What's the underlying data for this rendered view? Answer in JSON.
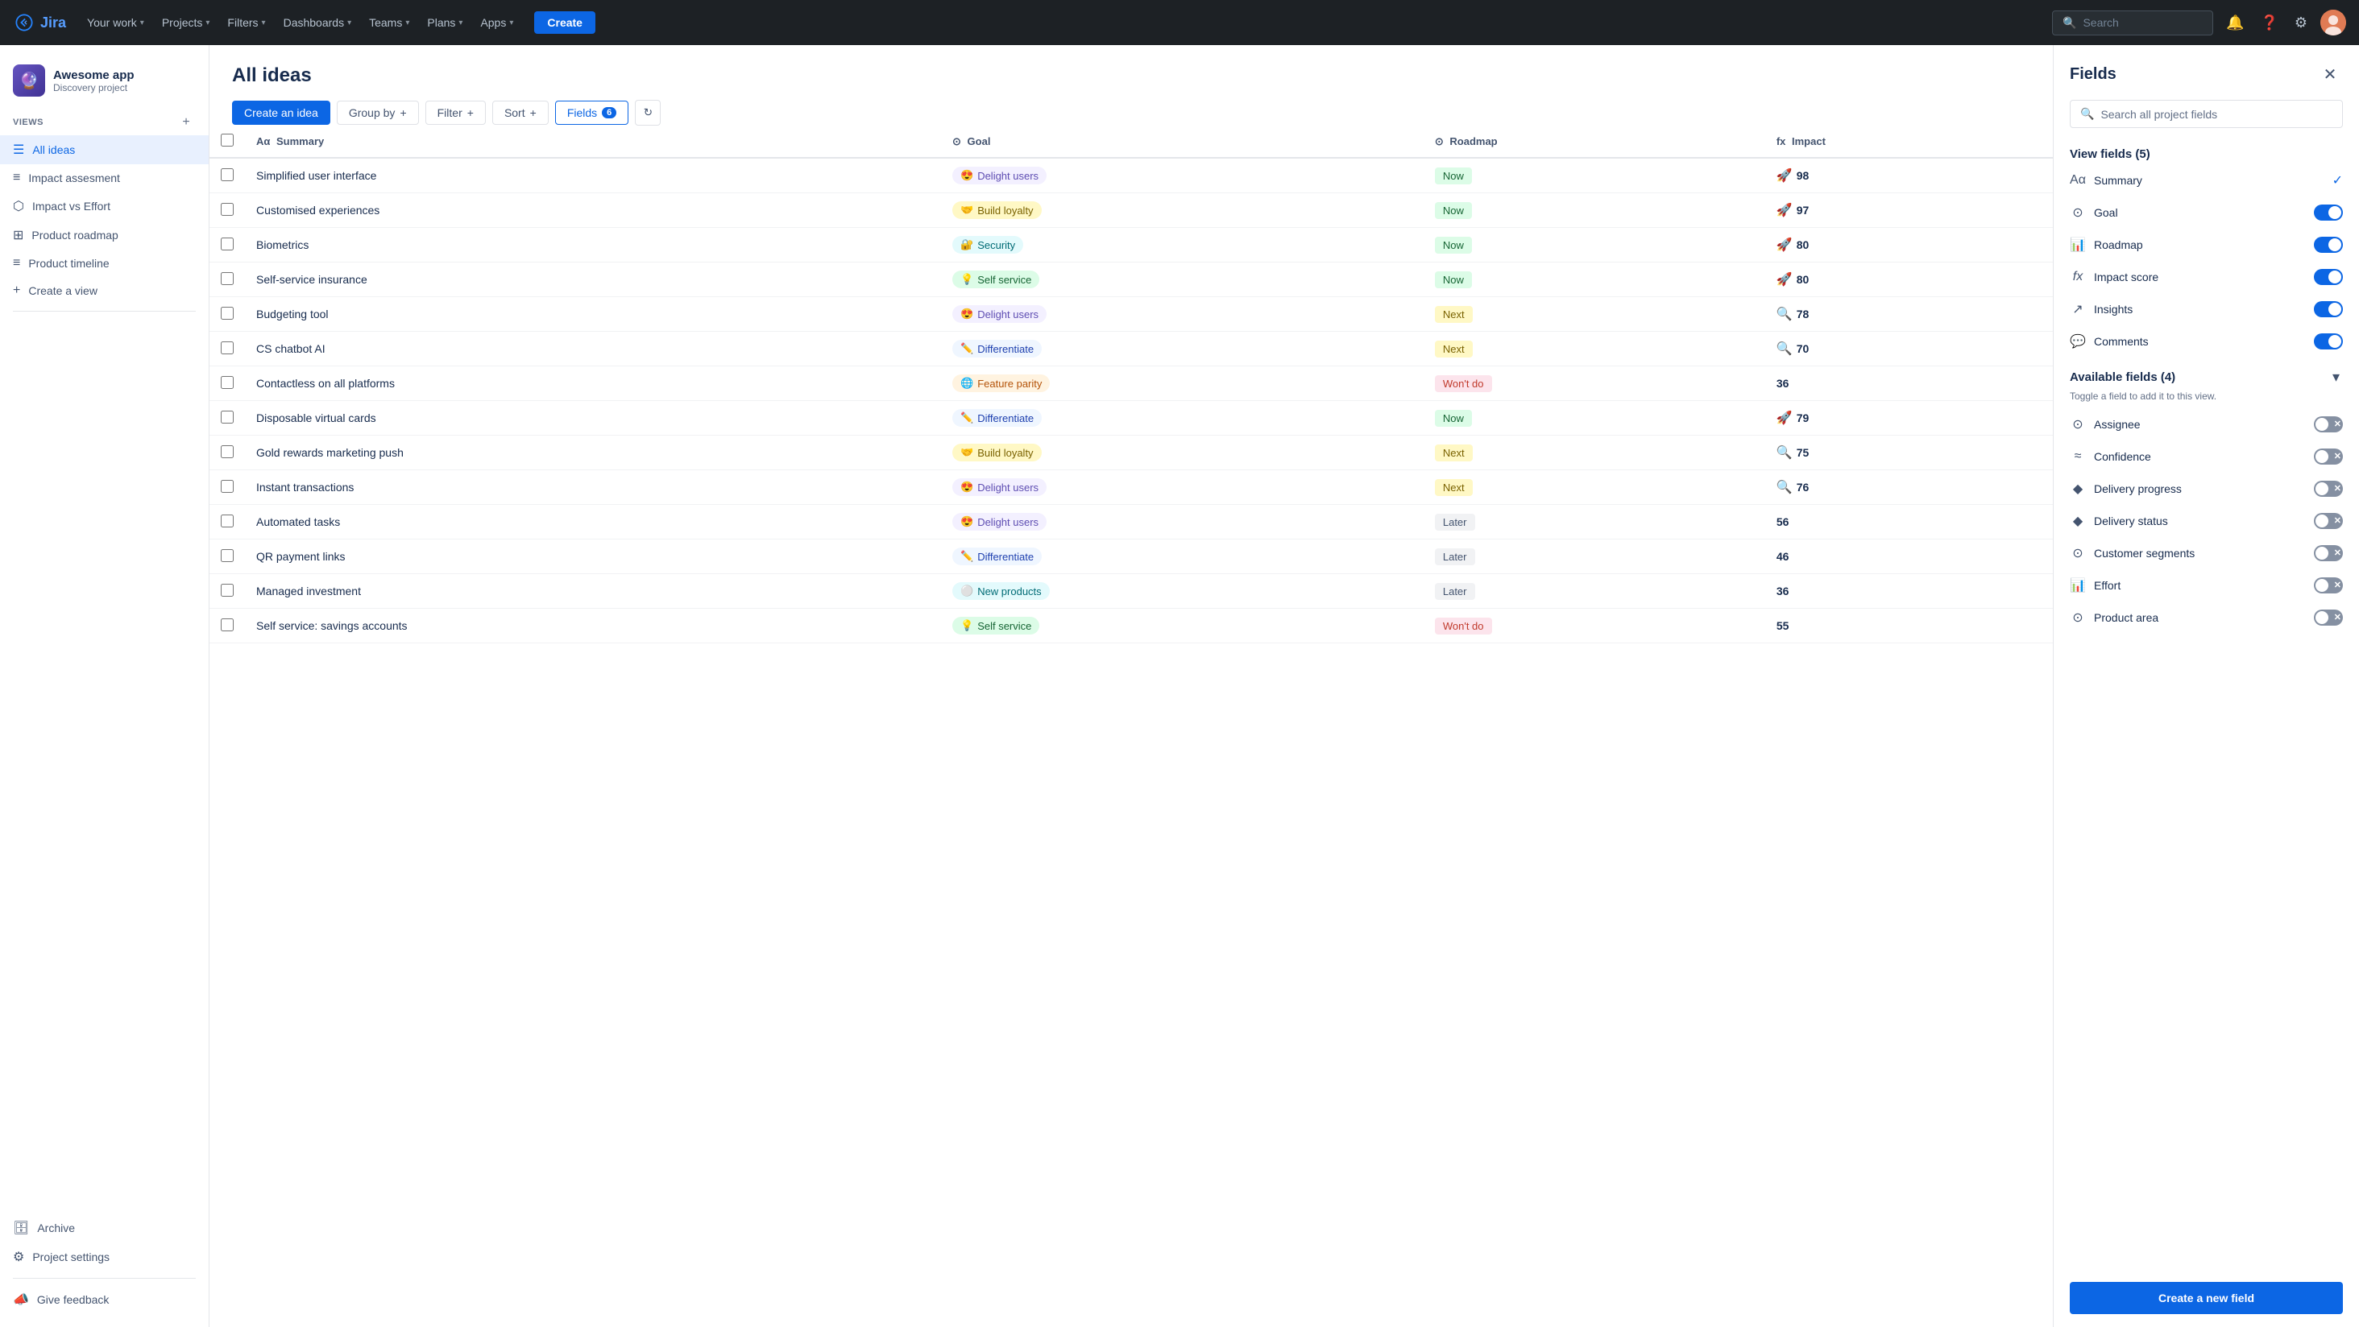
{
  "topnav": {
    "logo_text": "Jira",
    "nav_items": [
      {
        "label": "Your work",
        "has_dropdown": true
      },
      {
        "label": "Projects",
        "has_dropdown": true
      },
      {
        "label": "Filters",
        "has_dropdown": true
      },
      {
        "label": "Dashboards",
        "has_dropdown": true
      },
      {
        "label": "Teams",
        "has_dropdown": true
      },
      {
        "label": "Plans",
        "has_dropdown": true
      },
      {
        "label": "Apps",
        "has_dropdown": true
      }
    ],
    "create_label": "Create",
    "search_placeholder": "Search"
  },
  "sidebar": {
    "project_icon": "🔮",
    "project_name": "Awesome app",
    "project_type": "Discovery project",
    "views_label": "VIEWS",
    "views": [
      {
        "icon": "☰",
        "label": "All ideas",
        "active": true
      },
      {
        "icon": "≡",
        "label": "Impact assesment",
        "active": false
      },
      {
        "icon": "⬡",
        "label": "Impact vs Effort",
        "active": false
      },
      {
        "icon": "⊞",
        "label": "Product roadmap",
        "active": false
      },
      {
        "icon": "≡",
        "label": "Product timeline",
        "active": false
      },
      {
        "icon": "+",
        "label": "Create a view",
        "active": false
      }
    ],
    "bottom_items": [
      {
        "icon": "🗄",
        "label": "Archive"
      },
      {
        "icon": "⚙",
        "label": "Project settings"
      },
      {
        "icon": "📣",
        "label": "Give feedback"
      }
    ]
  },
  "main": {
    "title": "All ideas",
    "toolbar": {
      "create_idea": "Create an idea",
      "group_by": "Group by",
      "filter": "Filter",
      "sort": "Sort",
      "fields": "Fields",
      "fields_count": "6"
    },
    "table": {
      "columns": [
        {
          "label": "Summary",
          "icon": "Aα"
        },
        {
          "label": "Goal",
          "icon": "⊙"
        },
        {
          "label": "Roadmap",
          "icon": "⊙"
        },
        {
          "label": "Impact",
          "icon": "fx"
        }
      ],
      "rows": [
        {
          "summary": "Simplified user interface",
          "goal_emoji": "😍",
          "goal_label": "Delight users",
          "goal_class": "chip-purple",
          "roadmap": "Now",
          "roadmap_class": "roadmap-now",
          "impact": 98,
          "impact_icon": "🚀"
        },
        {
          "summary": "Customised experiences",
          "goal_emoji": "🤝",
          "goal_label": "Build loyalty",
          "goal_class": "chip-yellow",
          "roadmap": "Now",
          "roadmap_class": "roadmap-now",
          "impact": 97,
          "impact_icon": "🚀"
        },
        {
          "summary": "Biometrics",
          "goal_emoji": "🔐",
          "goal_label": "Security",
          "goal_class": "chip-teal",
          "roadmap": "Now",
          "roadmap_class": "roadmap-now",
          "impact": 80,
          "impact_icon": "🚀"
        },
        {
          "summary": "Self-service insurance",
          "goal_emoji": "💡",
          "goal_label": "Self service",
          "goal_class": "chip-green",
          "roadmap": "Now",
          "roadmap_class": "roadmap-now",
          "impact": 80,
          "impact_icon": "🚀"
        },
        {
          "summary": "Budgeting tool",
          "goal_emoji": "😍",
          "goal_label": "Delight users",
          "goal_class": "chip-purple",
          "roadmap": "Next",
          "roadmap_class": "roadmap-next",
          "impact": 78,
          "impact_icon": "🔍"
        },
        {
          "summary": "CS chatbot AI",
          "goal_emoji": "✏️",
          "goal_label": "Differentiate",
          "goal_class": "chip-blue",
          "roadmap": "Next",
          "roadmap_class": "roadmap-next",
          "impact": 70,
          "impact_icon": "🔍"
        },
        {
          "summary": "Contactless on all platforms",
          "goal_emoji": "🌐",
          "goal_label": "Feature parity",
          "goal_class": "chip-orange",
          "roadmap": "Won't do",
          "roadmap_class": "roadmap-wont",
          "impact": 36,
          "impact_icon": ""
        },
        {
          "summary": "Disposable virtual cards",
          "goal_emoji": "✏️",
          "goal_label": "Differentiate",
          "goal_class": "chip-blue",
          "roadmap": "Now",
          "roadmap_class": "roadmap-now",
          "impact": 79,
          "impact_icon": "🚀"
        },
        {
          "summary": "Gold rewards marketing push",
          "goal_emoji": "🤝",
          "goal_label": "Build loyalty",
          "goal_class": "chip-yellow",
          "roadmap": "Next",
          "roadmap_class": "roadmap-next",
          "impact": 75,
          "impact_icon": "🔍"
        },
        {
          "summary": "Instant transactions",
          "goal_emoji": "😍",
          "goal_label": "Delight users",
          "goal_class": "chip-purple",
          "roadmap": "Next",
          "roadmap_class": "roadmap-next",
          "impact": 76,
          "impact_icon": "🔍"
        },
        {
          "summary": "Automated tasks",
          "goal_emoji": "😍",
          "goal_label": "Delight users",
          "goal_class": "chip-purple",
          "roadmap": "Later",
          "roadmap_class": "roadmap-later",
          "impact": 56,
          "impact_icon": ""
        },
        {
          "summary": "QR payment links",
          "goal_emoji": "✏️",
          "goal_label": "Differentiate",
          "goal_class": "chip-blue",
          "roadmap": "Later",
          "roadmap_class": "roadmap-later",
          "impact": 46,
          "impact_icon": ""
        },
        {
          "summary": "Managed investment",
          "goal_emoji": "⚪",
          "goal_label": "New products",
          "goal_class": "chip-teal",
          "roadmap": "Later",
          "roadmap_class": "roadmap-later",
          "impact": 36,
          "impact_icon": ""
        },
        {
          "summary": "Self service: savings accounts",
          "goal_emoji": "💡",
          "goal_label": "Self service",
          "goal_class": "chip-green",
          "roadmap": "Won't do",
          "roadmap_class": "roadmap-wont",
          "impact": 55,
          "impact_icon": ""
        }
      ]
    }
  },
  "fields_panel": {
    "title": "Fields",
    "search_placeholder": "Search all project fields",
    "view_fields_label": "View fields (5)",
    "view_fields": [
      {
        "icon": "Aα",
        "label": "Summary",
        "toggled": null,
        "checked": true
      },
      {
        "icon": "⊙",
        "label": "Goal",
        "toggled": true,
        "checked": false
      },
      {
        "icon": "📊",
        "label": "Roadmap",
        "toggled": true,
        "checked": false
      },
      {
        "icon": "fx",
        "label": "Impact score",
        "toggled": true,
        "checked": false
      },
      {
        "icon": "↗",
        "label": "Insights",
        "toggled": true,
        "checked": false
      },
      {
        "icon": "💬",
        "label": "Comments",
        "toggled": true,
        "checked": false
      }
    ],
    "available_fields_label": "Available fields (4)",
    "available_fields_desc": "Toggle a field to add it to this view.",
    "available_fields": [
      {
        "icon": "⊙",
        "label": "Assignee"
      },
      {
        "icon": "≈",
        "label": "Confidence"
      },
      {
        "icon": "◆",
        "label": "Delivery progress"
      },
      {
        "icon": "◆",
        "label": "Delivery status"
      },
      {
        "icon": "⊙",
        "label": "Customer segments"
      },
      {
        "icon": "📊",
        "label": "Effort"
      },
      {
        "icon": "⊙",
        "label": "Product area"
      }
    ],
    "create_field_label": "Create a new field"
  }
}
